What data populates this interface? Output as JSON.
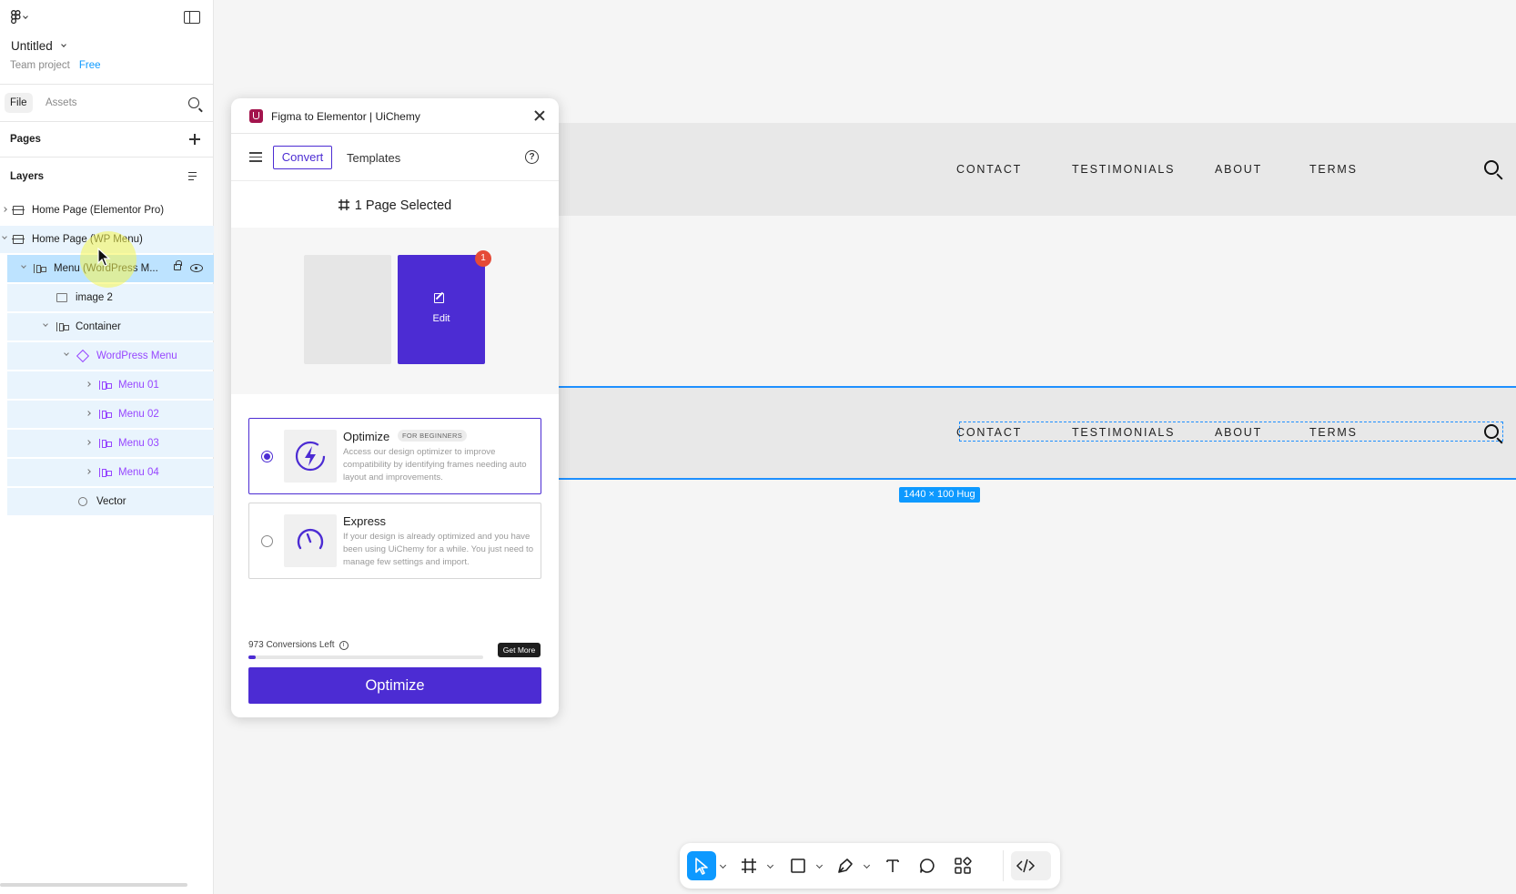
{
  "app": {
    "file_title": "Untitled",
    "team": "Team project",
    "plan": "Free"
  },
  "left_tabs": {
    "file": "File",
    "assets": "Assets"
  },
  "pages": {
    "label": "Pages"
  },
  "layers": {
    "label": "Layers",
    "items": [
      {
        "label": "Home Page (Elementor Pro)"
      },
      {
        "label": "Home Page (WP Menu)"
      },
      {
        "label": "Menu (WordPress M..."
      },
      {
        "label": "image 2"
      },
      {
        "label": "Container"
      },
      {
        "label": "WordPress Menu"
      },
      {
        "label": "Menu 01"
      },
      {
        "label": "Menu 02"
      },
      {
        "label": "Menu 03"
      },
      {
        "label": "Menu 04"
      },
      {
        "label": "Vector"
      }
    ]
  },
  "plugin": {
    "title": "Figma to Elementor | UiChemy",
    "convert": "Convert",
    "templates": "Templates",
    "pages_selected": "1 Page Selected",
    "edit": "Edit",
    "badge": "1",
    "options": [
      {
        "name": "Optimize",
        "tag": "FOR BEGINNERS",
        "desc": "Access our design optimizer to improve compatibility by identifying frames needing auto layout and improvements.",
        "selected": true
      },
      {
        "name": "Express",
        "desc": "If your design is already optimized and you have been using UiChemy for a while. You just need to manage few settings and import.",
        "selected": false
      }
    ],
    "conversions_left": "973 Conversions Left",
    "progress_fraction": 0.03,
    "get_more": "Get More",
    "optimize_button": "Optimize"
  },
  "canvas": {
    "nav_items": [
      "CONTACT",
      "TESTIMONIALS",
      "ABOUT",
      "TERMS"
    ],
    "size_badge": "1440 × 100 Hug"
  },
  "colors": {
    "accent": "#4c2cd3",
    "selection": "#0d99ff",
    "component": "#9747ff"
  }
}
